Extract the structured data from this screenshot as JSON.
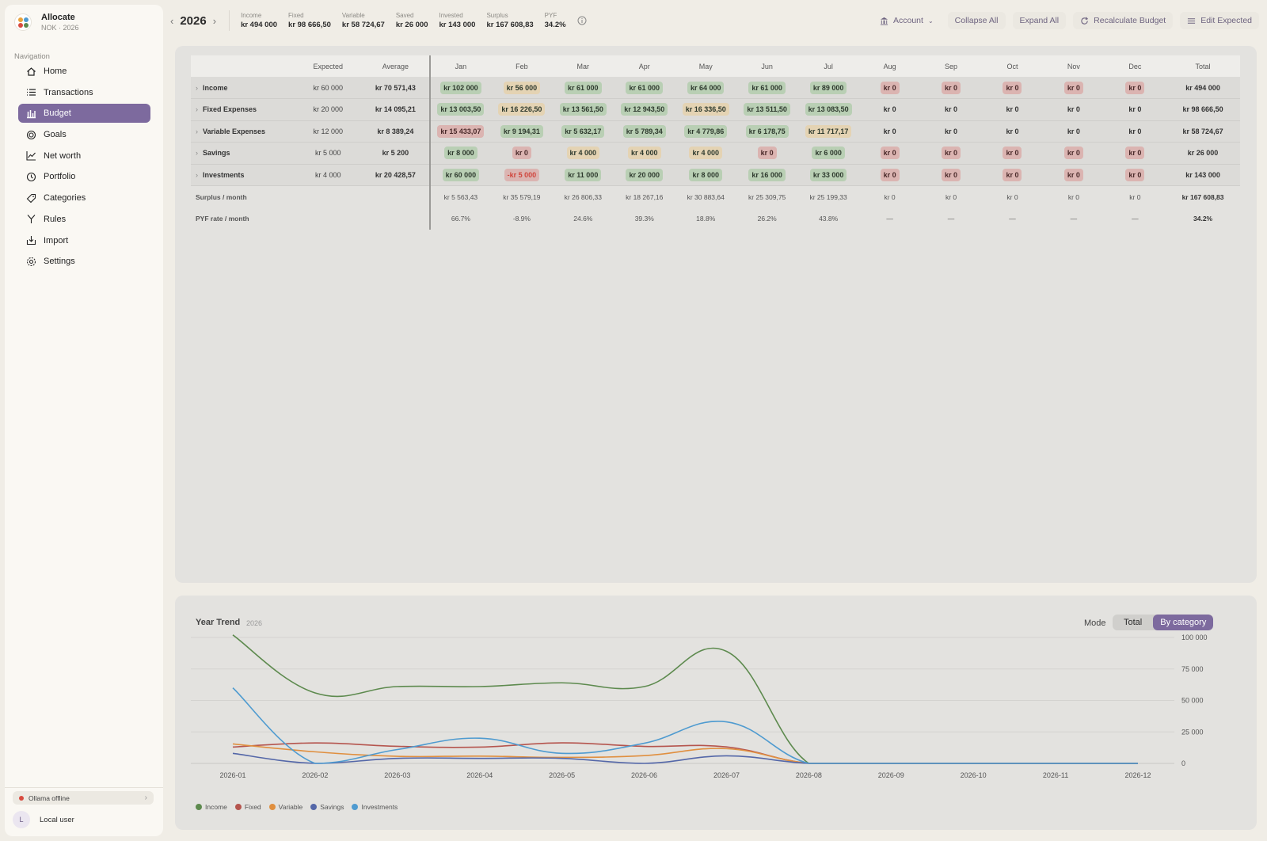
{
  "app": {
    "name": "Allocate",
    "subtitle": "NOK · 2026"
  },
  "nav": {
    "heading": "Navigation",
    "items": [
      {
        "label": "Home",
        "icon": "home-icon"
      },
      {
        "label": "Transactions",
        "icon": "list-icon"
      },
      {
        "label": "Budget",
        "icon": "chart-bar-icon"
      },
      {
        "label": "Goals",
        "icon": "target-icon"
      },
      {
        "label": "Net worth",
        "icon": "trend-icon"
      },
      {
        "label": "Portfolio",
        "icon": "clock-icon"
      },
      {
        "label": "Categories",
        "icon": "tag-icon"
      },
      {
        "label": "Rules",
        "icon": "branch-icon"
      },
      {
        "label": "Import",
        "icon": "import-icon"
      },
      {
        "label": "Settings",
        "icon": "gear-icon"
      }
    ]
  },
  "status": {
    "ollama": "Ollama offline",
    "user_initial": "L",
    "user_name": "Local user"
  },
  "topbar": {
    "year": "2026",
    "stats": [
      {
        "label": "Income",
        "value": "kr 494 000"
      },
      {
        "label": "Fixed",
        "value": "kr 98 666,50"
      },
      {
        "label": "Variable",
        "value": "kr 58 724,67"
      },
      {
        "label": "Saved",
        "value": "kr 26 000"
      },
      {
        "label": "Invested",
        "value": "kr 143 000"
      },
      {
        "label": "Surplus",
        "value": "kr 167 608,83"
      },
      {
        "label": "PYF",
        "value": "34.2%"
      }
    ],
    "account": "Account",
    "collapse_all": "Collapse All",
    "expand_all": "Expand All",
    "recalculate": "Recalculate Budget",
    "edit_expected": "Edit Expected"
  },
  "table": {
    "headers": [
      "",
      "Expected",
      "Average",
      "Jan",
      "Feb",
      "Mar",
      "Apr",
      "May",
      "Jun",
      "Jul",
      "Aug",
      "Sep",
      "Oct",
      "Nov",
      "Dec",
      "Total"
    ],
    "rows": [
      {
        "name": "Income",
        "expected": "kr 60 000",
        "average": "kr 70 571,43",
        "total": "kr 494 000",
        "cells": [
          [
            "kr 102 000",
            "g"
          ],
          [
            "kr 56 000",
            "y"
          ],
          [
            "kr 61 000",
            "g"
          ],
          [
            "kr 61 000",
            "g"
          ],
          [
            "kr 64 000",
            "g"
          ],
          [
            "kr 61 000",
            "g"
          ],
          [
            "kr 89 000",
            "g"
          ],
          [
            "kr 0",
            "r"
          ],
          [
            "kr 0",
            "r"
          ],
          [
            "kr 0",
            "r"
          ],
          [
            "kr 0",
            "r"
          ],
          [
            "kr 0",
            "r"
          ]
        ]
      },
      {
        "name": "Fixed Expenses",
        "expected": "kr 20 000",
        "average": "kr 14 095,21",
        "total": "kr 98 666,50",
        "cells": [
          [
            "kr 13 003,50",
            "g"
          ],
          [
            "kr 16 226,50",
            "y"
          ],
          [
            "kr 13 561,50",
            "g"
          ],
          [
            "kr 12 943,50",
            "g"
          ],
          [
            "kr 16 336,50",
            "y"
          ],
          [
            "kr 13 511,50",
            "g"
          ],
          [
            "kr 13 083,50",
            "g"
          ],
          [
            "kr 0",
            "p"
          ],
          [
            "kr 0",
            "p"
          ],
          [
            "kr 0",
            "p"
          ],
          [
            "kr 0",
            "p"
          ],
          [
            "kr 0",
            "p"
          ]
        ]
      },
      {
        "name": "Variable Expenses",
        "expected": "kr 12 000",
        "average": "kr 8 389,24",
        "total": "kr 58 724,67",
        "cells": [
          [
            "kr 15 433,07",
            "r"
          ],
          [
            "kr 9 194,31",
            "g"
          ],
          [
            "kr 5 632,17",
            "g"
          ],
          [
            "kr 5 789,34",
            "g"
          ],
          [
            "kr 4 779,86",
            "g"
          ],
          [
            "kr 6 178,75",
            "g"
          ],
          [
            "kr 11 717,17",
            "y"
          ],
          [
            "kr 0",
            "p"
          ],
          [
            "kr 0",
            "p"
          ],
          [
            "kr 0",
            "p"
          ],
          [
            "kr 0",
            "p"
          ],
          [
            "kr 0",
            "p"
          ]
        ]
      },
      {
        "name": "Savings",
        "expected": "kr 5 000",
        "average": "kr 5 200",
        "total": "kr 26 000",
        "cells": [
          [
            "kr 8 000",
            "g"
          ],
          [
            "kr 0",
            "r"
          ],
          [
            "kr 4 000",
            "y"
          ],
          [
            "kr 4 000",
            "y"
          ],
          [
            "kr 4 000",
            "y"
          ],
          [
            "kr 0",
            "r"
          ],
          [
            "kr 6 000",
            "g"
          ],
          [
            "kr 0",
            "r"
          ],
          [
            "kr 0",
            "r"
          ],
          [
            "kr 0",
            "r"
          ],
          [
            "kr 0",
            "r"
          ],
          [
            "kr 0",
            "r"
          ]
        ]
      },
      {
        "name": "Investments",
        "expected": "kr 4 000",
        "average": "kr 20 428,57",
        "total": "kr 143 000",
        "cells": [
          [
            "kr 60 000",
            "g"
          ],
          [
            "-kr 5 000",
            "rneg"
          ],
          [
            "kr 11 000",
            "g"
          ],
          [
            "kr 20 000",
            "g"
          ],
          [
            "kr 8 000",
            "g"
          ],
          [
            "kr 16 000",
            "g"
          ],
          [
            "kr 33 000",
            "g"
          ],
          [
            "kr 0",
            "r"
          ],
          [
            "kr 0",
            "r"
          ],
          [
            "kr 0",
            "r"
          ],
          [
            "kr 0",
            "r"
          ],
          [
            "kr 0",
            "r"
          ]
        ]
      }
    ],
    "surplus": {
      "name": "Surplus / month",
      "cells": [
        "kr 5 563,43",
        "kr 35 579,19",
        "kr 26 806,33",
        "kr 18 267,16",
        "kr 30 883,64",
        "kr 25 309,75",
        "kr 25 199,33",
        "kr 0",
        "kr 0",
        "kr 0",
        "kr 0",
        "kr 0"
      ],
      "total": "kr 167 608,83"
    },
    "pyf": {
      "name": "PYF rate / month",
      "cells": [
        "66.7%",
        "-8.9%",
        "24.6%",
        "39.3%",
        "18.8%",
        "26.2%",
        "43.8%",
        "—",
        "—",
        "—",
        "—",
        "—"
      ],
      "total": "34.2%"
    }
  },
  "trend": {
    "title": "Year Trend",
    "year": "2026",
    "mode_label": "Mode",
    "mode_options": [
      "Total",
      "By category"
    ],
    "mode_selected": "By category"
  },
  "chart_data": {
    "type": "line",
    "x": [
      "2026-01",
      "2026-02",
      "2026-03",
      "2026-04",
      "2026-05",
      "2026-06",
      "2026-07",
      "2026-08",
      "2026-09",
      "2026-10",
      "2026-11",
      "2026-12"
    ],
    "ylim": [
      0,
      100000
    ],
    "yticks": [
      "0",
      "25 000",
      "50 000",
      "75 000",
      "100 000"
    ],
    "grid": true,
    "legend_position": "bottom-left",
    "series": [
      {
        "name": "Income",
        "color": "#5d8a4e",
        "values": [
          102000,
          56000,
          61000,
          61000,
          64000,
          61000,
          89000,
          0,
          0,
          0,
          0,
          0
        ]
      },
      {
        "name": "Fixed",
        "color": "#b5554e",
        "values": [
          13003.5,
          16226.5,
          13561.5,
          12943.5,
          16336.5,
          13511.5,
          13083.5,
          0,
          0,
          0,
          0,
          0
        ]
      },
      {
        "name": "Variable",
        "color": "#e08f3f",
        "values": [
          15433.07,
          9194.31,
          5632.17,
          5789.34,
          4779.86,
          6178.75,
          11717.17,
          0,
          0,
          0,
          0,
          0
        ]
      },
      {
        "name": "Savings",
        "color": "#5467a8",
        "values": [
          8000,
          0,
          4000,
          4000,
          4000,
          0,
          6000,
          0,
          0,
          0,
          0,
          0
        ]
      },
      {
        "name": "Investments",
        "color": "#4f9bd0",
        "values": [
          60000,
          -5000,
          11000,
          20000,
          8000,
          16000,
          33000,
          0,
          0,
          0,
          0,
          0
        ]
      }
    ]
  }
}
